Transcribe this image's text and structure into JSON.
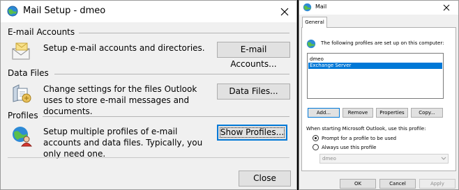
{
  "mail_setup": {
    "title": "Mail Setup - dmeo",
    "close_icon": "close-icon",
    "email_accounts": {
      "heading": "E-mail Accounts",
      "icon": "email-accounts-icon",
      "description": "Setup e-mail accounts and directories.",
      "button": "E-mail Accounts..."
    },
    "data_files": {
      "heading": "Data Files",
      "icon": "data-files-icon",
      "description": "Change settings for the files Outlook uses to store e-mail messages and documents.",
      "button": "Data Files..."
    },
    "profiles": {
      "heading": "Profiles",
      "icon": "profiles-icon",
      "description": "Setup multiple profiles of e-mail accounts and data files. Typically, you only need one.",
      "button": "Show Profiles..."
    },
    "close_button": "Close"
  },
  "mail": {
    "title": "Mail",
    "tab": "General",
    "intro_text": "The following profiles are set up on this computer:",
    "profiles": [
      {
        "name": "dmeo",
        "selected": false
      },
      {
        "name": "Exchange Server",
        "selected": true
      }
    ],
    "buttons": {
      "add": "Add...",
      "remove": "Remove",
      "properties": "Properties",
      "copy": "Copy..."
    },
    "startup_label": "When starting Microsoft Outlook, use this profile:",
    "radio_prompt": "Prompt for a profile to be used",
    "radio_always": "Always use this profile",
    "selected_radio": "prompt",
    "profile_combo": "dmeo",
    "footer": {
      "ok": "OK",
      "cancel": "Cancel",
      "apply": "Apply"
    }
  },
  "colors": {
    "accent": "#0078d7",
    "selection": "#0078d7"
  }
}
